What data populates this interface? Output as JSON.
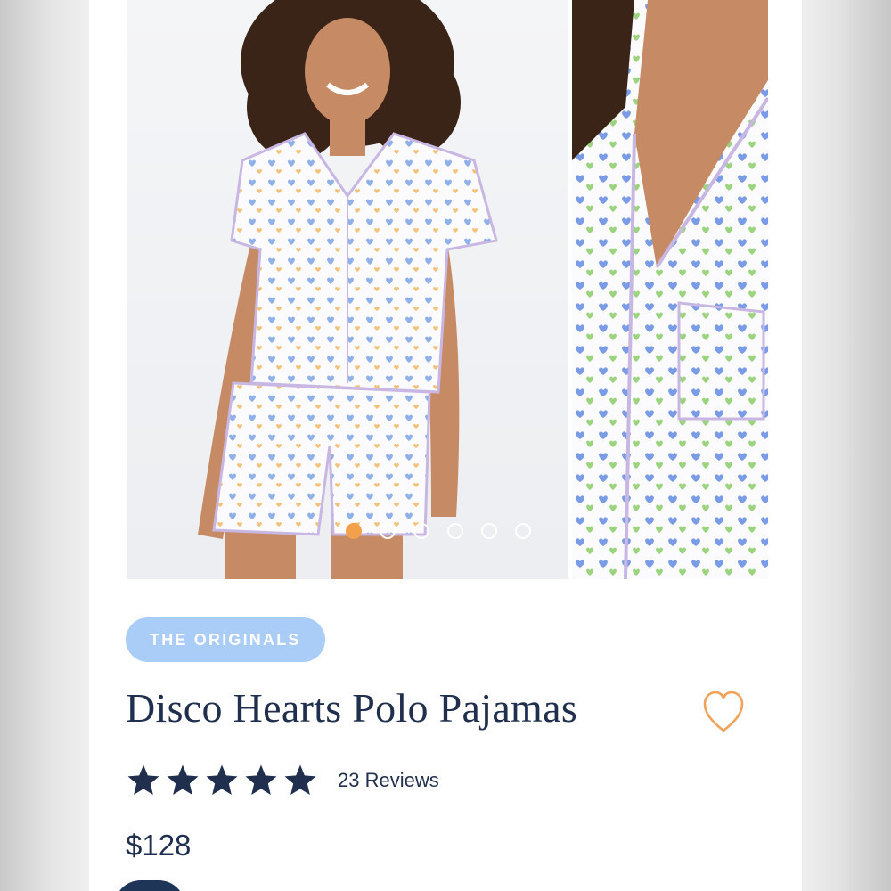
{
  "carousel": {
    "dot_count": 6,
    "active_index": 0,
    "colors": {
      "active_dot": "#f3a04c",
      "inactive_dot": "#ffffff"
    }
  },
  "product": {
    "collection_badge": "THE ORIGINALS",
    "title": "Disco Hearts Polo Pajamas",
    "rating": {
      "stars": 5,
      "max": 5
    },
    "reviews_label": "23 Reviews",
    "price": "$128"
  },
  "icons": {
    "favorite": "heart-outline-icon",
    "rating": "star-icon"
  },
  "colors": {
    "primary_text": "#1f2f4d",
    "badge_bg": "#a9cdf7",
    "favorite_outline": "#f0a25a",
    "star_fill": "#1f2f4d"
  }
}
